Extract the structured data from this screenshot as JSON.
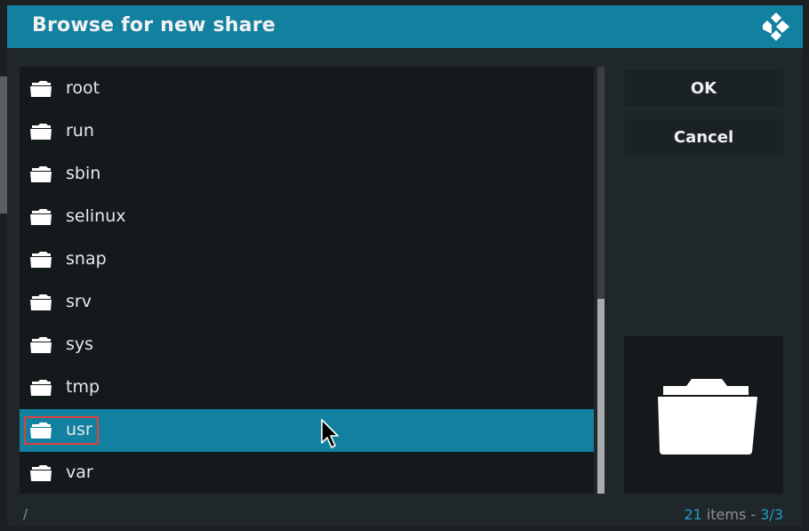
{
  "dialog": {
    "title": "Browse for new share",
    "logo_icon": "kodi-logo-icon"
  },
  "list": {
    "items": [
      {
        "label": "root",
        "icon": "folder-icon"
      },
      {
        "label": "run",
        "icon": "folder-icon"
      },
      {
        "label": "sbin",
        "icon": "folder-icon"
      },
      {
        "label": "selinux",
        "icon": "folder-icon"
      },
      {
        "label": "snap",
        "icon": "folder-icon"
      },
      {
        "label": "srv",
        "icon": "folder-icon"
      },
      {
        "label": "sys",
        "icon": "folder-icon"
      },
      {
        "label": "tmp",
        "icon": "folder-icon"
      },
      {
        "label": "usr",
        "icon": "folder-icon",
        "selected": true
      },
      {
        "label": "var",
        "icon": "folder-icon"
      }
    ],
    "scroll_position_fraction": 0.54
  },
  "buttons": {
    "ok_label": "OK",
    "cancel_label": "Cancel"
  },
  "preview": {
    "icon": "folder-open-icon"
  },
  "footer": {
    "path": "/",
    "count": "21",
    "items_word": "items",
    "separator": "-",
    "page": "3/3"
  },
  "colors": {
    "accent": "#12809f",
    "background": "#20272b",
    "list_background": "#14191b",
    "highlight_box": "#e0403a"
  }
}
